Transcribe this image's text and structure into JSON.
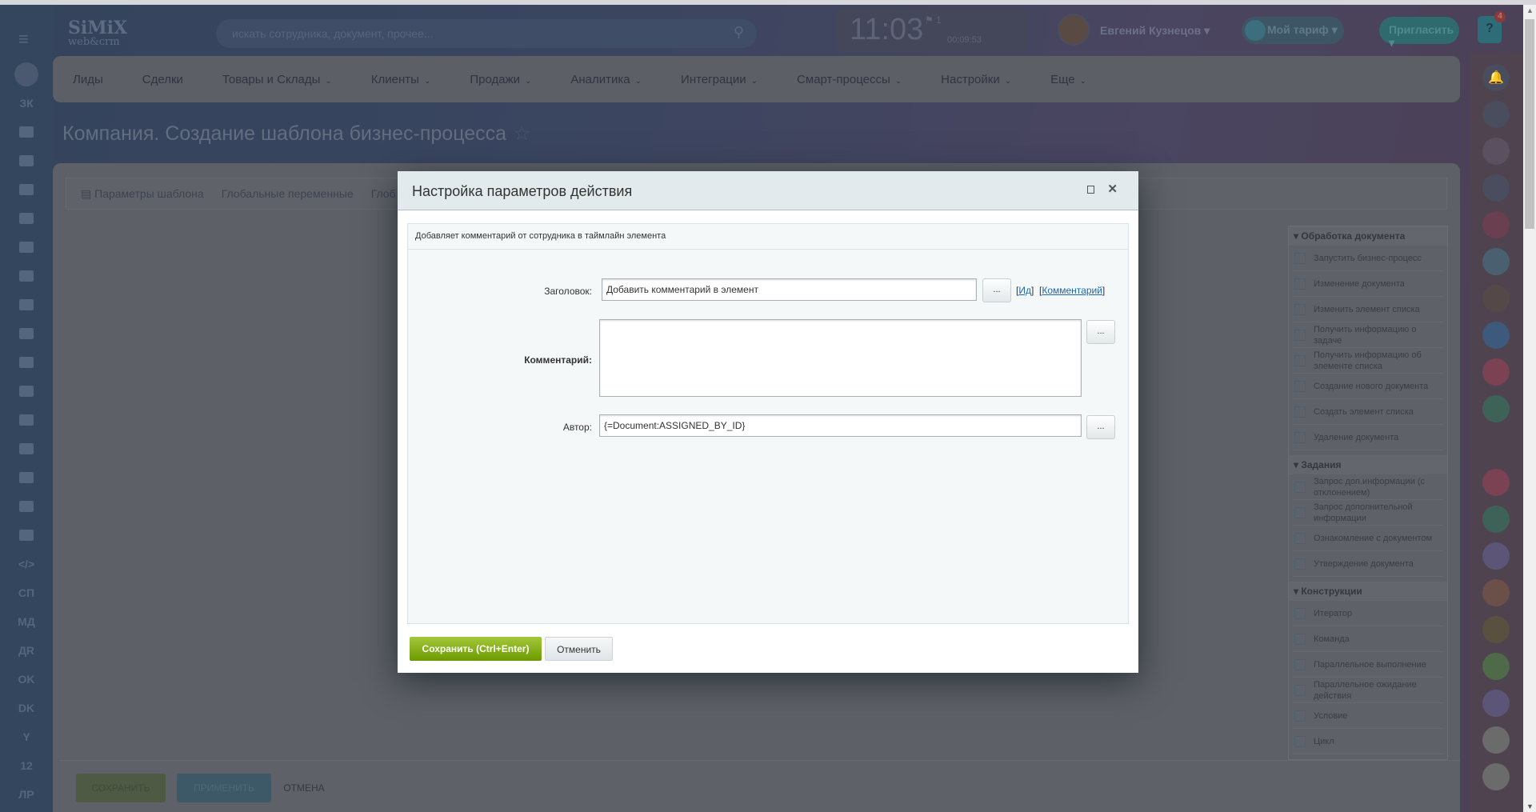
{
  "header": {
    "logo": "SiMiX",
    "logo_sub": "web&crm",
    "search_placeholder": "искать сотрудника, документ, прочее...",
    "clock_time": "11:03",
    "clock_flag": "1",
    "clock_timer": "00:09:53",
    "user_name": "Евгений Кузнецов",
    "tariff": "Мой тариф",
    "invite": "Пригласить",
    "help": "?",
    "help_badge": "4"
  },
  "left_sidebar": {
    "items": [
      {
        "icon": "filter-icon"
      },
      {
        "label": "ЗК"
      },
      {
        "icon": "cart-icon"
      },
      {
        "icon": "target-icon"
      },
      {
        "icon": "task-icon"
      },
      {
        "icon": "group-icon"
      },
      {
        "icon": "feed-icon"
      },
      {
        "icon": "chat-icon"
      },
      {
        "icon": "calendar-icon"
      },
      {
        "icon": "document-icon"
      },
      {
        "icon": "drive-icon"
      },
      {
        "icon": "mail-icon"
      },
      {
        "icon": "users-icon"
      },
      {
        "icon": "contact-card-icon"
      },
      {
        "icon": "robot-icon"
      },
      {
        "icon": "box-icon"
      },
      {
        "icon": "stripes-icon"
      },
      {
        "label": "</>"
      },
      {
        "label": "СП"
      },
      {
        "label": "МД"
      },
      {
        "label": "ДR"
      },
      {
        "label": "OK"
      },
      {
        "label": "DK"
      },
      {
        "label": "Y"
      },
      {
        "label": "12"
      },
      {
        "label": "ЛР"
      }
    ]
  },
  "nav": {
    "items": [
      {
        "label": "Лиды",
        "dropdown": false
      },
      {
        "label": "Сделки",
        "dropdown": false
      },
      {
        "label": "Товары и Склады",
        "dropdown": true
      },
      {
        "label": "Клиенты",
        "dropdown": true
      },
      {
        "label": "Продажи",
        "dropdown": true
      },
      {
        "label": "Аналитика",
        "dropdown": true
      },
      {
        "label": "Интеграции",
        "dropdown": true
      },
      {
        "label": "Смарт-процессы",
        "dropdown": true
      },
      {
        "label": "Настройки",
        "dropdown": true
      },
      {
        "label": "Еще",
        "dropdown": true
      }
    ],
    "chevron": "⌄"
  },
  "page": {
    "title": "Компания. Создание шаблона бизнес-процесса",
    "star": "☆",
    "tabs": [
      "Параметры шаблона",
      "Глобальные переменные",
      "Глоб"
    ]
  },
  "activities": {
    "sections": [
      {
        "title": "Обработка документа",
        "items": [
          "Запустить бизнес-процесс",
          "Изменение документа",
          "Изменить элемент списка",
          "Получить информацию о задаче",
          "Получить информацию об элементе списка",
          "Создание нового документа",
          "Создать элемент списка",
          "Удаление документа"
        ]
      },
      {
        "title": "Задания",
        "items": [
          "Запрос доп.информации (с отклонением)",
          "Запрос дополнительной информации",
          "Ознакомление с документом",
          "Утверждение документа"
        ]
      },
      {
        "title": "Конструкции",
        "items": [
          "Итератор",
          "Команда",
          "Параллельное выполнение",
          "Параллельное ожидание действия",
          "Условие",
          "Цикл"
        ]
      }
    ]
  },
  "bottom": {
    "save": "СОХРАНИТЬ",
    "apply": "ПРИМЕНИТЬ",
    "cancel": "ОТМЕНА"
  },
  "dialog": {
    "title": "Настройка параметров действия",
    "description": "Добавляет комментарий от сотрудника в таймлайн элемента",
    "fields": {
      "title_label": "Заголовок:",
      "title_value": "Добавить комментарий в элемент",
      "comment_label": "Комментарий:",
      "comment_value": "",
      "author_label": "Автор:",
      "author_value": "{=Document:ASSIGNED_BY_ID}",
      "dots": "...",
      "link_id": "Ид",
      "link_comment": "Комментарий"
    },
    "save": "Сохранить (Ctrl+Enter)",
    "cancel": "Отменить"
  },
  "right_sidebar": {
    "colors": [
      "#4a4d5e",
      "#5a5060",
      "#4a4d5e",
      "#6a4050",
      "#4a6070",
      "#544848",
      "#3d5a7c",
      "#7a4252",
      "#3e6258",
      "#4f4350",
      "#7a4252",
      "#3e6258",
      "#5c5577",
      "#6a5048",
      "#5a5040",
      "#4e6a48",
      "#5c5577",
      "#6b6b6b",
      "#6b6b6b"
    ]
  }
}
